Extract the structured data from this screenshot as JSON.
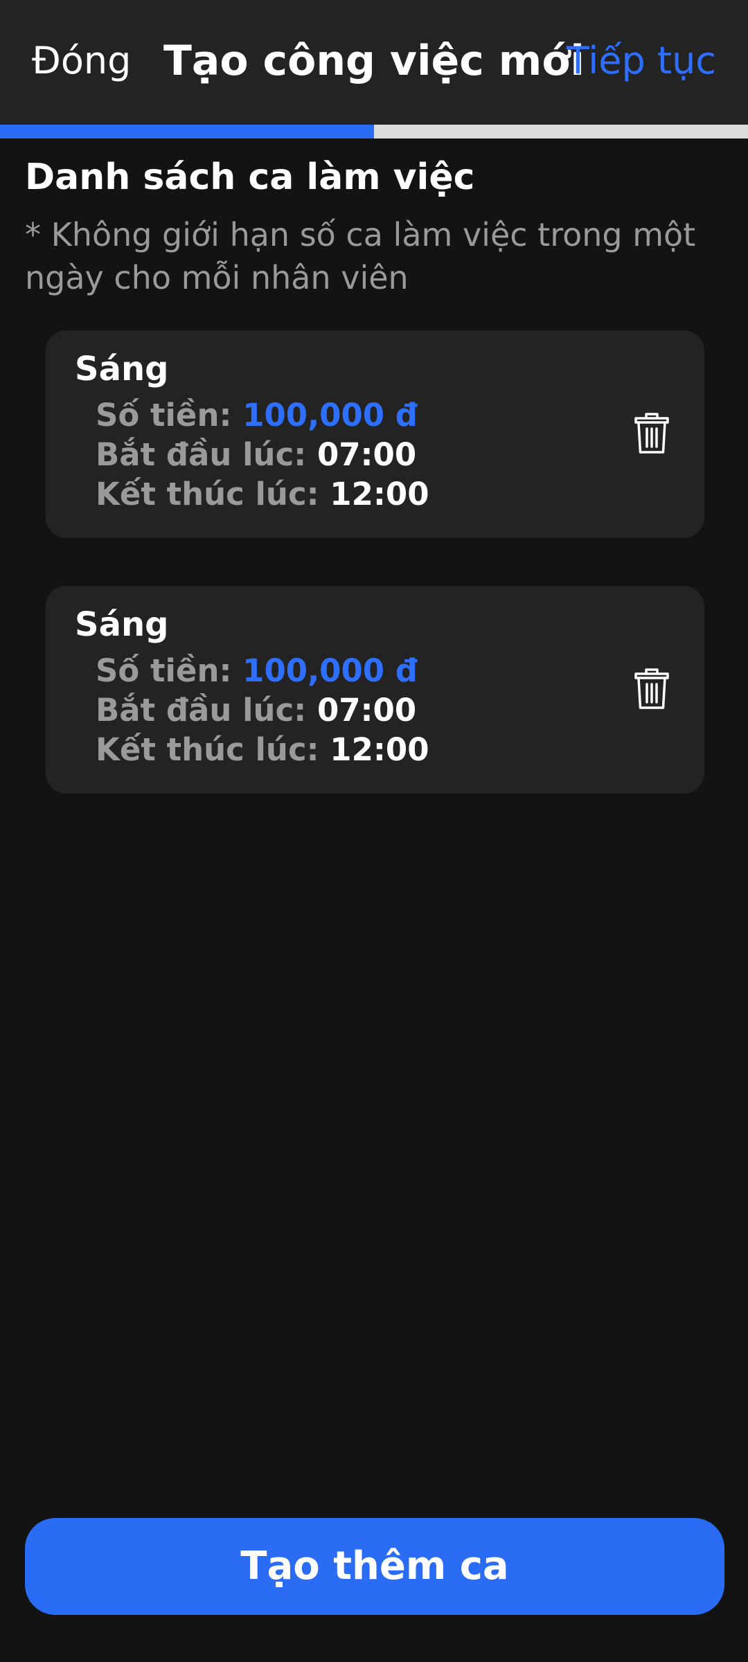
{
  "header": {
    "close_label": "Đóng",
    "title": "Tạo công việc mới",
    "next_label": "Tiếp tục"
  },
  "progress": {
    "fraction": 0.5,
    "fill_color": "#2a6df4",
    "track_color": "#dcdcdc"
  },
  "section": {
    "title": "Danh sách ca làm việc",
    "note": "* Không giới hạn số ca làm việc trong một ngày cho mỗi nhân viên"
  },
  "shifts": [
    {
      "name": "Sáng",
      "amount_label": "Số tiền:",
      "amount": "100,000 đ",
      "start_label": "Bắt đầu lúc:",
      "start": "07:00",
      "end_label": "Kết thúc lúc:",
      "end": "12:00",
      "delete_icon": "trash-icon"
    },
    {
      "name": "Sáng",
      "amount_label": "Số tiền:",
      "amount": "100,000 đ",
      "start_label": "Bắt đầu lúc:",
      "start": "07:00",
      "end_label": "Kết thúc lúc:",
      "end": "12:00",
      "delete_icon": "trash-icon"
    }
  ],
  "footer": {
    "add_shift_label": "Tạo thêm ca"
  },
  "colors": {
    "background": "#131313",
    "surface": "#232323",
    "accent": "#2f6fff",
    "muted_text": "#9a9a9a"
  }
}
